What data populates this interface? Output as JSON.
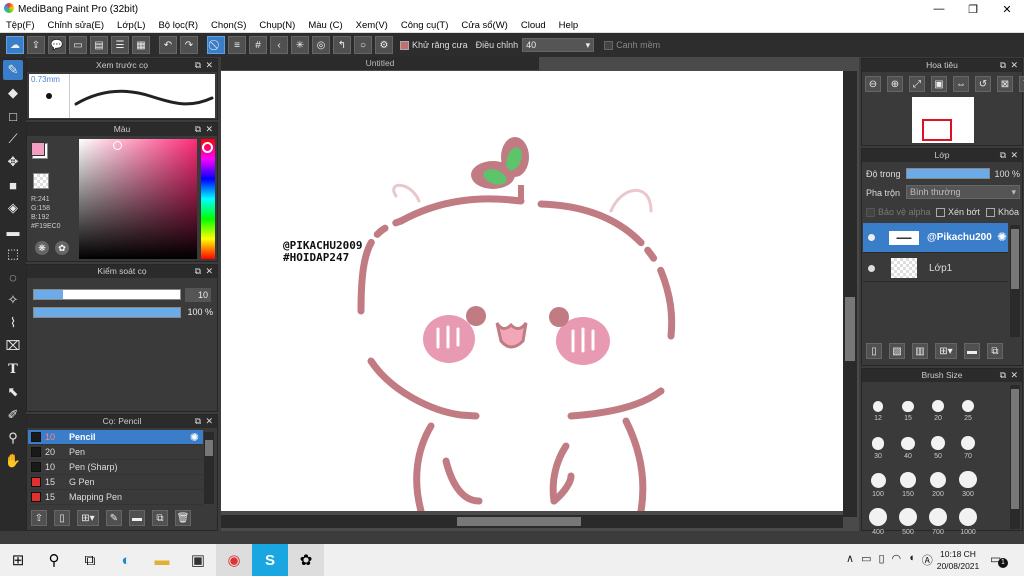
{
  "window": {
    "title": "MediBang Paint Pro (32bit)",
    "minimize": "—",
    "maximize": "❐",
    "close": "✕"
  },
  "menu": [
    "Tệp(F)",
    "Chỉnh sửa(E)",
    "Lớp(L)",
    "Bộ lọc(R)",
    "Chọn(S)",
    "Chụp(N)",
    "Màu (C)",
    "Xem(V)",
    "Công cụ(T)",
    "Cửa sổ(W)",
    "Cloud",
    "Help"
  ],
  "toolbar": {
    "antialias_label": "Khử răng cưa",
    "correction_label": "Điều chỉnh",
    "correction_value": "40",
    "edge_label": "Canh mềm"
  },
  "preview": {
    "title": "Xem trước cọ",
    "size_text": "0.73mm"
  },
  "color": {
    "title": "Màu",
    "r": "R:241",
    "g": "G:158",
    "b": "B:192",
    "hex": "#F19EC0",
    "current": "#F19EC0"
  },
  "brushctl": {
    "title": "Kiểm soát cọ",
    "size_value": "10",
    "opacity_value": "100 %",
    "size_fraction": 0.2,
    "opacity_fraction": 1.0
  },
  "brushes": {
    "title": "Cọ: Pencil",
    "items": [
      {
        "size": "10",
        "name": "Pencil",
        "color": "#1a1a1a",
        "selected": true
      },
      {
        "size": "20",
        "name": "Pen",
        "color": "#1a1a1a",
        "selected": false
      },
      {
        "size": "10",
        "name": "Pen (Sharp)",
        "color": "#1a1a1a",
        "selected": false
      },
      {
        "size": "15",
        "name": "G Pen",
        "color": "#e03030",
        "selected": false
      },
      {
        "size": "15",
        "name": "Mapping Pen",
        "color": "#e03030",
        "selected": false
      }
    ]
  },
  "canvas": {
    "tab_title": "Untitled",
    "watermark_line1": "@PIKACHU2009",
    "watermark_line2": "#HOIDAP247"
  },
  "navigator": {
    "title": "Hoa tiêu"
  },
  "layers": {
    "title": "Lớp",
    "opacity_label": "Độ trong",
    "opacity_value": "100 %",
    "blend_label": "Pha trộn",
    "blend_value": "Bình thường",
    "protect_alpha": "Bảo vệ alpha",
    "clipping": "Xén bớt",
    "lock": "Khóa",
    "items": [
      {
        "name": "@Pikachu200",
        "selected": true
      },
      {
        "name": "Lớp1",
        "selected": false
      }
    ]
  },
  "brushsize": {
    "title": "Brush Size",
    "sizes": [
      "12",
      "15",
      "20",
      "25",
      "30",
      "40",
      "50",
      "70",
      "100",
      "150",
      "200",
      "300",
      "400",
      "500",
      "700",
      "1000"
    ]
  },
  "taskbar": {
    "time": "10:18 CH",
    "date": "20/08/2021",
    "notification_count": "1"
  }
}
